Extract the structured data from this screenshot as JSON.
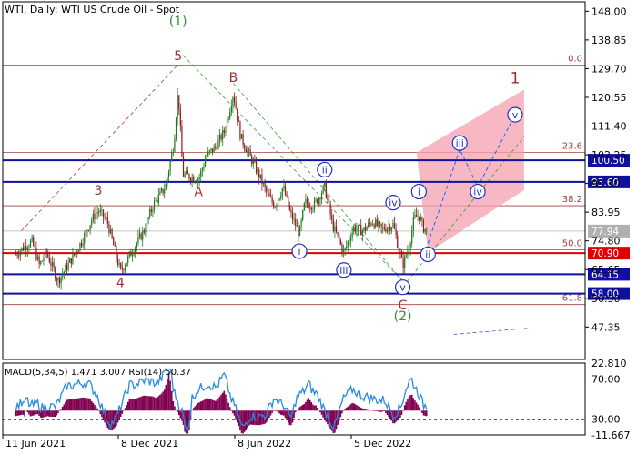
{
  "header": {
    "title": "WTI, Daily:  WTI US Crude Oil - Spot"
  },
  "macd_label": "MACD(5,34,5) 1.471 3.007 RSI(14) 50.37",
  "colors": {
    "up": "#1a7a1a",
    "down": "#8b1a1a",
    "hline_blue": "#1010a0",
    "hline_red": "#e00000",
    "fib": "#a04040",
    "wave_red": "#a03030",
    "wave_green": "#3a8a3a",
    "circle_wave": "#2030c0",
    "channel": "#f4a0b0",
    "macd_hist": "#800050",
    "rsi": "#2a8ae0"
  },
  "chart_data": {
    "type": "candlestick",
    "title": "WTI, Daily:  WTI US Crude Oil - Spot",
    "ylim": [
      37.0,
      151.0
    ],
    "y_ticks": [
      "148.00",
      "138.85",
      "129.70",
      "120.55",
      "111.40",
      "102.25",
      "93.10",
      "83.95",
      "74.80",
      "65.65",
      "56.50",
      "47.35"
    ],
    "x_ticks": [
      "11 Jun 2021",
      "8 Dec 2021",
      "8 Jun 2022",
      "5 Dec 2022"
    ],
    "price_path": [
      [
        "2021-06-11",
        70.5
      ],
      [
        "2021-06-25",
        73.0
      ],
      [
        "2021-07-08",
        74.5
      ],
      [
        "2021-07-20",
        67.0
      ],
      [
        "2021-08-01",
        71.0
      ],
      [
        "2021-08-20",
        62.0
      ],
      [
        "2021-09-10",
        68.5
      ],
      [
        "2021-09-28",
        74.5
      ],
      [
        "2021-10-15",
        81.5
      ],
      [
        "2021-10-26",
        84.5
      ],
      [
        "2021-11-10",
        81.0
      ],
      [
        "2021-11-25",
        70.0
      ],
      [
        "2021-12-02",
        65.0
      ],
      [
        "2021-12-20",
        71.0
      ],
      [
        "2022-01-10",
        78.0
      ],
      [
        "2022-01-25",
        86.0
      ],
      [
        "2022-02-15",
        92.0
      ],
      [
        "2022-03-01",
        106.0
      ],
      [
        "2022-03-08",
        123.0
      ],
      [
        "2022-03-16",
        96.0
      ],
      [
        "2022-04-11",
        94.5
      ],
      [
        "2022-04-25",
        102.0
      ],
      [
        "2022-05-10",
        105.0
      ],
      [
        "2022-05-25",
        110.0
      ],
      [
        "2022-06-08",
        122.0
      ],
      [
        "2022-06-20",
        108.0
      ],
      [
        "2022-07-05",
        102.0
      ],
      [
        "2022-07-20",
        96.0
      ],
      [
        "2022-08-05",
        89.0
      ],
      [
        "2022-08-16",
        86.0
      ],
      [
        "2022-08-30",
        92.0
      ],
      [
        "2022-09-10",
        84.0
      ],
      [
        "2022-09-26",
        77.0
      ],
      [
        "2022-10-05",
        87.0
      ],
      [
        "2022-10-20",
        86.0
      ],
      [
        "2022-11-07",
        92.0
      ],
      [
        "2022-11-20",
        80.0
      ],
      [
        "2022-12-09",
        71.0
      ],
      [
        "2022-12-25",
        79.0
      ],
      [
        "2023-01-10",
        78.0
      ],
      [
        "2023-01-25",
        81.0
      ],
      [
        "2023-02-10",
        78.5
      ],
      [
        "2023-03-01",
        80.0
      ],
      [
        "2023-03-17",
        67.0
      ],
      [
        "2023-03-28",
        73.5
      ],
      [
        "2023-04-05",
        82.0
      ],
      [
        "2023-04-13",
        83.0
      ],
      [
        "2023-04-20",
        79.0
      ],
      [
        "2023-04-28",
        77.9
      ]
    ],
    "horizontal_levels": [
      {
        "price": 100.5,
        "label": "100.50",
        "color": "blue"
      },
      {
        "price": 93.6,
        "label": "93.60",
        "color": "blue"
      },
      {
        "price": 70.9,
        "label": "70.90",
        "color": "red"
      },
      {
        "price": 64.15,
        "label": "64.15",
        "color": "blue"
      },
      {
        "price": 58.0,
        "label": "58.00",
        "color": "blue"
      },
      {
        "price": 77.94,
        "label": "77.94",
        "color": "grey"
      }
    ],
    "fibonacci_levels": [
      {
        "label": "0.0",
        "price": 130.8
      },
      {
        "label": "23.6",
        "price": 103.0
      },
      {
        "label": "38.2",
        "price": 86.0
      },
      {
        "label": "50.0",
        "price": 72.0
      },
      {
        "label": "61.8",
        "price": 54.5
      }
    ],
    "wave_labels": [
      {
        "text": "(1)",
        "date": "2022-03-08",
        "price": 143.5,
        "style": "green"
      },
      {
        "text": "5",
        "date": "2022-03-08",
        "price": 132.5,
        "style": "red"
      },
      {
        "text": "B",
        "date": "2022-06-08",
        "price": 125.5,
        "style": "red"
      },
      {
        "text": "3",
        "date": "2021-10-26",
        "price": 89.5,
        "style": "red"
      },
      {
        "text": "A",
        "date": "2022-04-11",
        "price": 89.0,
        "style": "red"
      },
      {
        "text": "4",
        "date": "2021-12-02",
        "price": 60.0,
        "style": "red"
      },
      {
        "text": "C",
        "date": "2023-03-17",
        "price": 53.0,
        "style": "red"
      },
      {
        "text": "(2)",
        "date": "2023-03-17",
        "price": 49.5,
        "style": "green"
      },
      {
        "text": "1",
        "date": "2023-09-20",
        "price": 125.0,
        "style": "red"
      },
      {
        "text": "i",
        "date": "2022-09-26",
        "price": 71.5,
        "style": "circle"
      },
      {
        "text": "ii",
        "date": "2022-11-07",
        "price": 97.5,
        "style": "circle"
      },
      {
        "text": "iii",
        "date": "2022-12-09",
        "price": 65.5,
        "style": "circle"
      },
      {
        "text": "iv",
        "date": "2023-03-01",
        "price": 87.0,
        "style": "circle"
      },
      {
        "text": "v",
        "date": "2023-03-17",
        "price": 60.0,
        "style": "circle"
      },
      {
        "text": "i",
        "date": "2023-04-13",
        "price": 90.5,
        "style": "circle"
      },
      {
        "text": "ii",
        "date": "2023-04-28",
        "price": 70.5,
        "style": "circle"
      },
      {
        "text": "iii",
        "date": "2023-06-20",
        "price": 106.0,
        "style": "circle"
      },
      {
        "text": "iv",
        "date": "2023-07-20",
        "price": 90.5,
        "style": "circle"
      },
      {
        "text": "v",
        "date": "2023-09-20",
        "price": 115.0,
        "style": "circle"
      }
    ],
    "macd_panel": {
      "y_ticks": [
        "22.810",
        "70.00",
        "30.00",
        "-11.667"
      ],
      "rsi_ylim": [
        14,
        86
      ],
      "macd_ylim": [
        -11.667,
        22.81
      ]
    }
  }
}
